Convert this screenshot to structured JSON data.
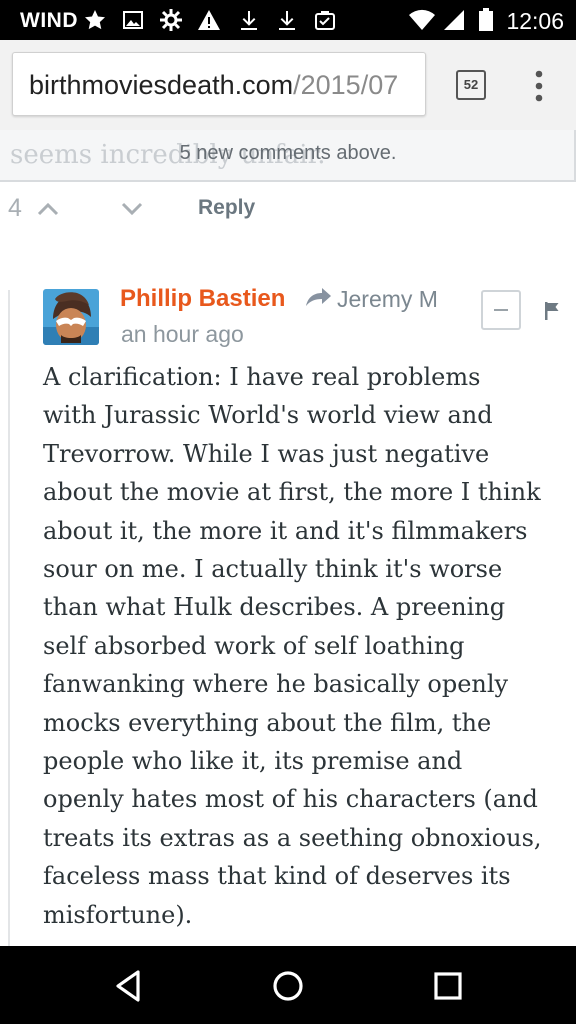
{
  "status_bar": {
    "carrier": "WIND",
    "time": "12:06",
    "icons": [
      "star-icon",
      "image-icon",
      "settings-icon",
      "warning-icon",
      "download-icon",
      "download-icon",
      "clipboard-check-icon",
      "wifi-icon",
      "signal-icon",
      "battery-icon"
    ]
  },
  "browser": {
    "url_domain": "birthmoviesdeath.com",
    "url_path": "/2015/07",
    "tab_count": "52",
    "menu_icon": "overflow-menu-icon"
  },
  "banner": {
    "ghost_text": "seems incredibly unfair.",
    "text": "5 new comments above."
  },
  "vote_row": {
    "count": "4",
    "reply_label": "Reply"
  },
  "comment": {
    "author": "Phillip Bastien",
    "reply_to": "Jeremy M",
    "timestamp": "an hour ago",
    "lines": [
      "A clarification: I have real problems",
      "with Jurassic World's world view and",
      "Trevorrow. While I was just negative",
      "about the movie at first, the more I think",
      "about it, the more it and it's filmmakers",
      "sour on me. I actually think it's worse",
      "than what Hulk describes. A preening",
      "self absorbed work of self loathing",
      "fanwanking where he basically openly",
      "mocks everything about the film, the",
      "people who like it, its premise and",
      "openly hates most of his characters (and",
      "treats its extras as a seething obnoxious,",
      "faceless mass that kind of deserves its",
      "misfortune)."
    ]
  },
  "nav_bar": {
    "icons": [
      "back-icon",
      "home-icon",
      "recents-icon"
    ]
  },
  "colors": {
    "author": "#e8581c",
    "body_text": "#2c3438",
    "meta": "#8d979e"
  }
}
